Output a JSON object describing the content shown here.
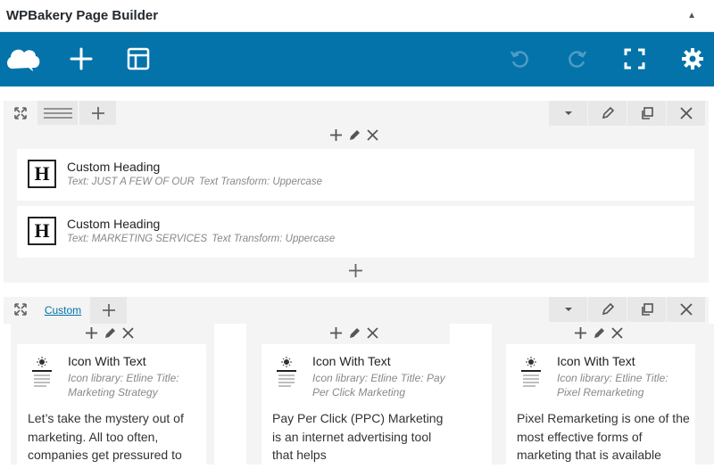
{
  "app": {
    "title": "WPBakery Page Builder",
    "collapse_icon": "triangle-up-icon"
  },
  "toolbar": {
    "icons": [
      "logo-cloud-icon",
      "add-element-icon",
      "templates-icon",
      "undo-icon",
      "redo-icon",
      "fullscreen-icon",
      "settings-icon"
    ],
    "accent": "#0473aa"
  },
  "row1": {
    "elements": [
      {
        "name": "Custom Heading",
        "param1": "Text: JUST A FEW OF OUR",
        "param2": "Text Transform: Uppercase",
        "icon_letter": "H"
      },
      {
        "name": "Custom Heading",
        "param1": "Text: MARKETING SERVICES",
        "param2": "Text Transform: Uppercase",
        "icon_letter": "H"
      }
    ]
  },
  "row2": {
    "layout_label": "Custom",
    "cards": [
      {
        "name": "Icon With Text",
        "params": "Icon library: Etline  Title: Marketing Strategy",
        "body": "Let’s take the mystery out of marketing. All too often, companies get pressured to"
      },
      {
        "name": "Icon With Text",
        "params": "Icon library: Etline  Title: Pay Per Click Marketing",
        "body": "Pay Per Click (PPC) Marketing is an internet advertising tool that helps"
      },
      {
        "name": "Icon With Text",
        "params": "Icon library: Etline  Title: Pixel Remarketing",
        "body": "Pixel Remarketing is one of the most effective forms of marketing that is available"
      }
    ]
  }
}
